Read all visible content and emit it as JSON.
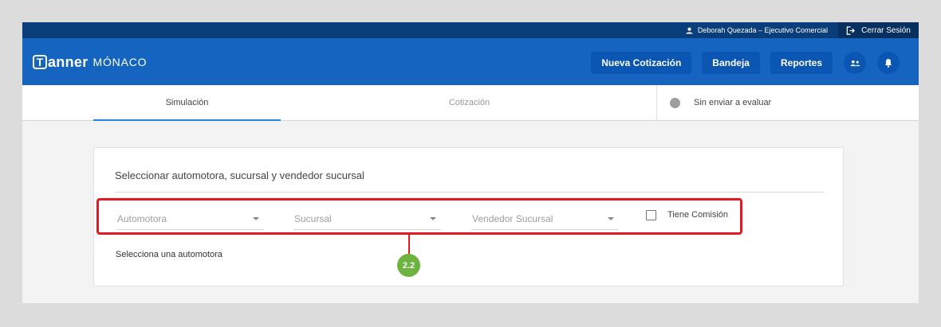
{
  "topbar": {
    "user": "Deborah Quezada – Ejecutivo Comercial",
    "logout": "Cerrar Sesión"
  },
  "header": {
    "logo_letter": "T",
    "brand": "anner",
    "product": "MÓNACO",
    "nav": [
      "Nueva Cotización",
      "Bandeja",
      "Reportes"
    ]
  },
  "tabs": {
    "simulacion": "Simulación",
    "cotizacion": "Cotización",
    "status": "Sin enviar a evaluar"
  },
  "form": {
    "title": "Seleccionar automotora, sucursal y vendedor sucursal",
    "automotora": "Automotora",
    "sucursal": "Sucursal",
    "vendedor": "Vendedor Sucursal",
    "comision": "Tiene Comisión",
    "hint": "Selecciona una automotora"
  },
  "annotation": {
    "step": "2.2"
  },
  "colors": {
    "header": "#1565c0",
    "topbar": "#0a3e7a",
    "accent": "#1e88e5",
    "highlight": "#e21b23",
    "badge": "#6cb33f"
  }
}
